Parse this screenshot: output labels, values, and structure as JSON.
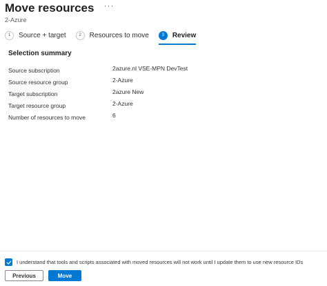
{
  "header": {
    "title": "Move resources",
    "more": "···",
    "subtitle": "2-Azure"
  },
  "steps": [
    {
      "number": "1",
      "label": "Source + target",
      "state": "complete"
    },
    {
      "number": "2",
      "label": "Resources to move",
      "state": "complete"
    },
    {
      "number": "3",
      "label": "Review",
      "state": "active"
    }
  ],
  "summary": {
    "title": "Selection summary",
    "rows": [
      {
        "label": "Source subscription",
        "value": "2azure.nl VSE-MPN DevTest"
      },
      {
        "label": "Source resource group",
        "value": "2-Azure"
      },
      {
        "label": "Target subscription",
        "value": "2azure New"
      },
      {
        "label": "Target resource group",
        "value": "2-Azure"
      },
      {
        "label": "Number of resources to move",
        "value": "6"
      }
    ]
  },
  "consent": {
    "checked": true,
    "text": "I understand that tools and scripts associated with moved resources will not work until I update them to use new resource IDs"
  },
  "buttons": {
    "previous": "Previous",
    "move": "Move"
  },
  "colors": {
    "accent": "#0078d4",
    "text": "#323130",
    "muted": "#605e5c"
  }
}
